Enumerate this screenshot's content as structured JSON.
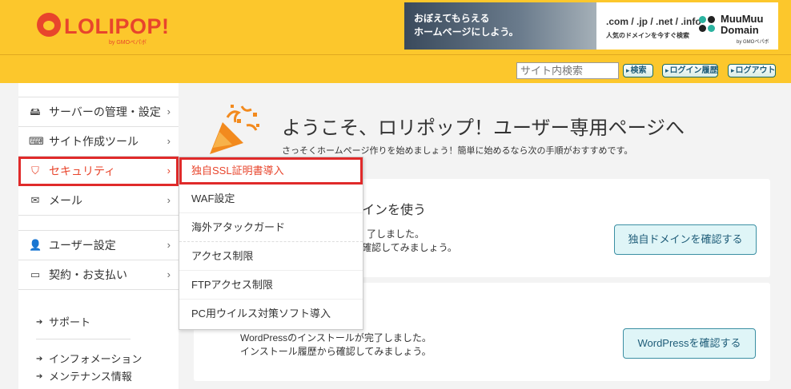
{
  "header": {
    "logo_text": "LOLIPOP!",
    "logo_sub": "by GMOペパボ",
    "banner": {
      "line1": "おぼえてもらえる",
      "line2": "ホームページにしよう。",
      "domains": ".com / .jp / .net / .info",
      "tagline": "人気のドメインを今すぐ検索",
      "brand1": "MuuMuu",
      "brand2": "Domain",
      "brand_sub": "by GMOペパボ"
    },
    "search_placeholder": "サイト内検索",
    "search_button": "検索",
    "login_history_button": "ログイン履歴",
    "logout_button": "ログアウト"
  },
  "sidebar": {
    "items": [
      {
        "label": "サーバーの管理・設定",
        "icon": "server-icon"
      },
      {
        "label": "サイト作成ツール",
        "icon": "laptop-icon"
      },
      {
        "label": "セキュリティ",
        "icon": "shield-icon"
      },
      {
        "label": "メール",
        "icon": "mail-icon"
      },
      {
        "label": "ユーザー設定",
        "icon": "user-icon"
      },
      {
        "label": "契約・お支払い",
        "icon": "credit-card-icon"
      }
    ],
    "links": [
      "サポート",
      "インフォメーション",
      "メンテナンス情報"
    ]
  },
  "dropdown": {
    "items": [
      "独自SSL証明書導入",
      "WAF設定",
      "海外アタックガード",
      "アクセス制限",
      "FTPアクセス制限",
      "PC用ウイルス対策ソフト導入"
    ]
  },
  "main": {
    "title": "ようこそ、ロリポップ！ユーザー専用ページへ",
    "subtitle": "さっそくホームページ作りを始めましょう！簡単に始めるなら次の手順がおすすめです。",
    "card1": {
      "title_fragment": "インを使う",
      "line1_fragment": "了しました。",
      "line2_fragment": "確認してみましょう。",
      "button": "独自ドメインを確認する"
    },
    "card2": {
      "line1": "WordPressのインストールが完了しました。",
      "line2": "インストール履歴から確認してみましょう。",
      "button": "WordPressを確認する"
    }
  },
  "colors": {
    "header_bg": "#fcc72c",
    "brand_red": "#e8452c",
    "highlight_border": "#e02a2a",
    "button_bg": "#dff5f7"
  }
}
